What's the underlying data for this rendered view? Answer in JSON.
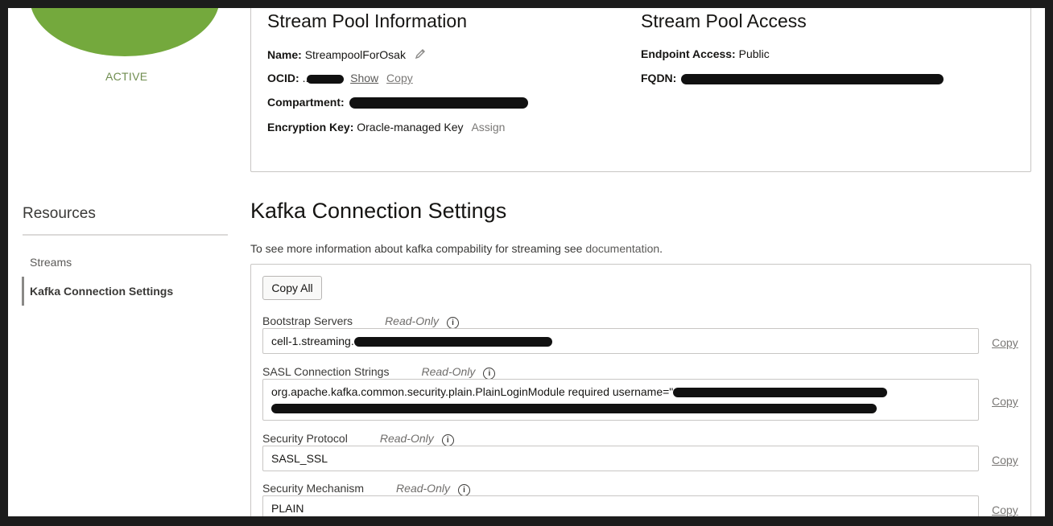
{
  "status": {
    "label": "ACTIVE",
    "color": "#74a93d"
  },
  "info": {
    "title": "Stream Pool Information",
    "name_label": "Name:",
    "name_value": "StreampoolForOsak",
    "ocid_label": "OCID:",
    "ocid_value": "...",
    "show_link": "Show",
    "copy_link": "Copy",
    "compartment_label": "Compartment:",
    "encryption_label": "Encryption Key:",
    "encryption_value": "Oracle-managed Key",
    "assign_link": "Assign"
  },
  "access": {
    "title": "Stream Pool Access",
    "endpoint_label": "Endpoint Access:",
    "endpoint_value": "Public",
    "fqdn_label": "FQDN:"
  },
  "sidebar": {
    "title": "Resources",
    "items": [
      {
        "label": "Streams",
        "active": false
      },
      {
        "label": "Kafka Connection Settings",
        "active": true
      }
    ]
  },
  "kafka": {
    "title": "Kafka Connection Settings",
    "desc_prefix": "To see more information about kafka compability for streaming see ",
    "doc_link": "documentation",
    "desc_suffix": ".",
    "copy_all": "Copy All",
    "read_only": "Read-Only",
    "copy_label": "Copy",
    "fields": [
      {
        "label": "Bootstrap Servers",
        "value": "cell-1.streaming."
      },
      {
        "label": "SASL Connection Strings",
        "value": "org.apache.kafka.common.security.plain.PlainLoginModule required username=\""
      },
      {
        "label": "Security Protocol",
        "value": "SASL_SSL"
      },
      {
        "label": "Security Mechanism",
        "value": "PLAIN"
      }
    ]
  }
}
